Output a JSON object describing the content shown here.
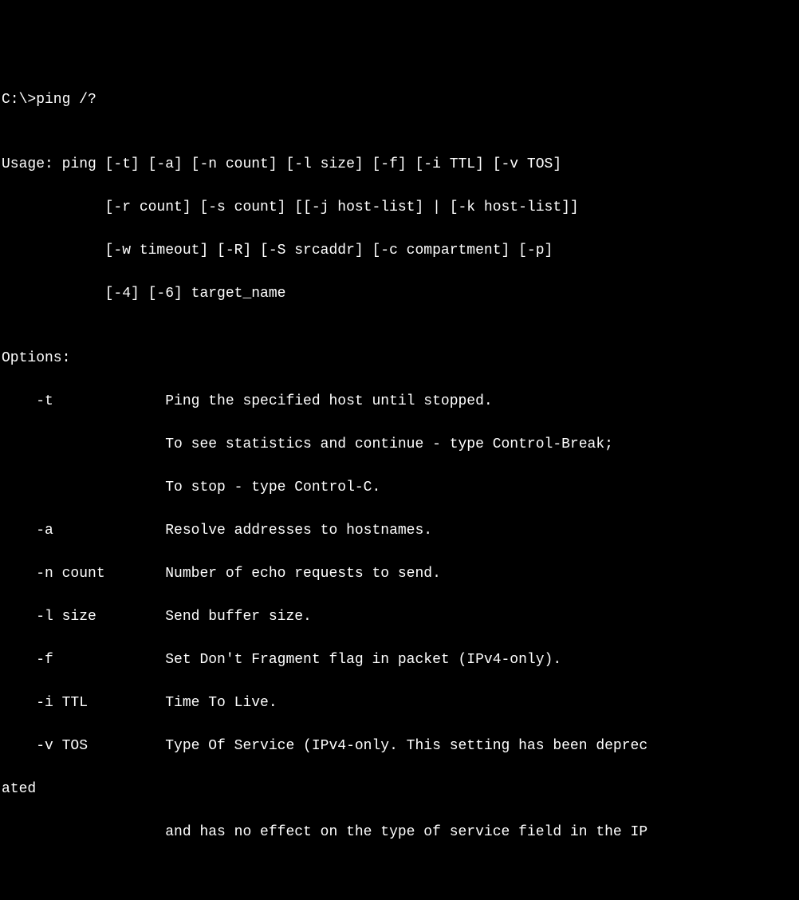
{
  "prompt": "C:\\>ping /?",
  "blank1": "",
  "usage1": "Usage: ping [-t] [-a] [-n count] [-l size] [-f] [-i TTL] [-v TOS]",
  "usage2": "            [-r count] [-s count] [[-j host-list] | [-k host-list]]",
  "usage3": "            [-w timeout] [-R] [-S srcaddr] [-c compartment] [-p]",
  "usage4": "            [-4] [-6] target_name",
  "blank2": "",
  "options_header": "Options:",
  "opt_t_1": "    -t             Ping the specified host until stopped.",
  "opt_t_2": "                   To see statistics and continue - type Control-Break;",
  "opt_t_3": "                   To stop - type Control-C.",
  "opt_a": "    -a             Resolve addresses to hostnames.",
  "opt_n": "    -n count       Number of echo requests to send.",
  "opt_l": "    -l size        Send buffer size.",
  "opt_f": "    -f             Set Don't Fragment flag in packet (IPv4-only).",
  "opt_i": "    -i TTL         Time To Live.",
  "opt_v_1": "    -v TOS         Type Of Service (IPv4-only. This setting has been deprec",
  "opt_v_2": "ated",
  "opt_v_3": "                   and has no effect on the type of service field in the IP"
}
